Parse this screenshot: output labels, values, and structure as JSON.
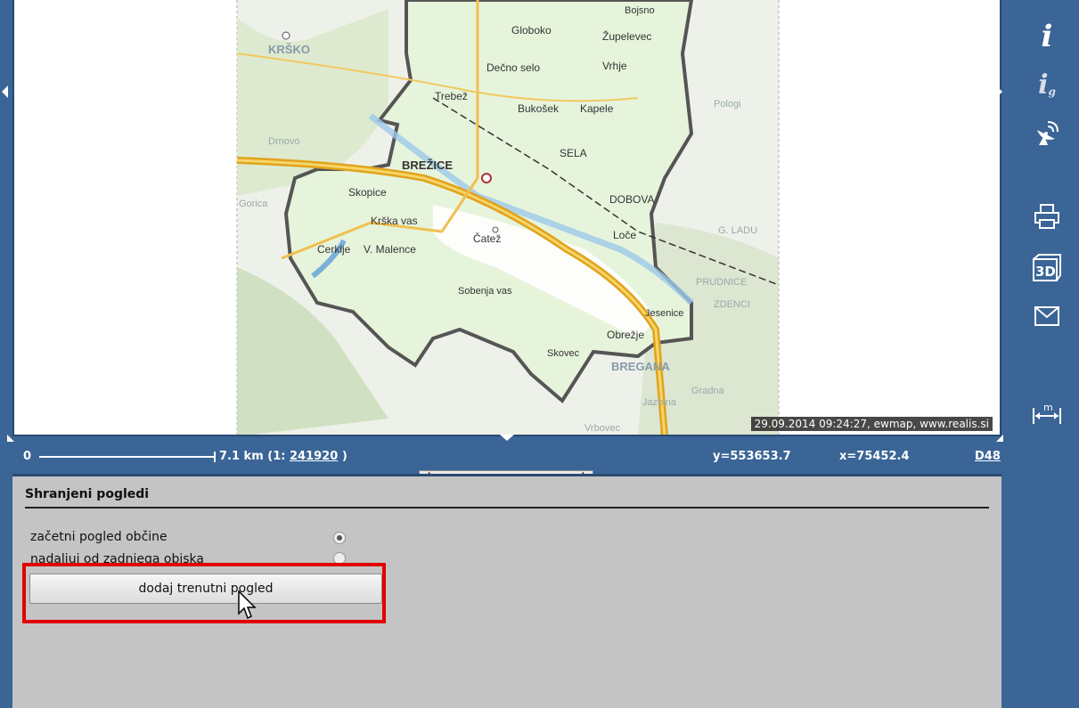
{
  "map": {
    "stamp": "29.09.2014 09:24:27, ewmap, www.realis.si",
    "place_labels": {
      "brezice": "BREŽICE",
      "krsko": "KRŠKO",
      "bregana": "BREGANA",
      "dobova": "DOBOVA",
      "catez": "Čatež",
      "skopice": "Skopice",
      "krska_vas": "Krška vas",
      "cerklje": "Cerklje",
      "velike_malence": "V. Malence",
      "globoko": "Globoko",
      "zupelevec": "Župelevec",
      "vrhje": "Vrhje",
      "desno_selo": "Dečno selo",
      "trebez": "Trebež",
      "bukosek": "Bukošek",
      "kapele": "Kapele",
      "sela": "SELA",
      "loce": "Loče",
      "obrezje": "Obrežje",
      "jesenice": "Jesenice",
      "sobenja_vas": "Sobenja vas",
      "pologi": "Pologi",
      "prudnice": "PRUDNICE",
      "zdenci": "ZDENCI",
      "g_ladu": "G. LADU",
      "gradna": "Gradna",
      "jazbina": "Jazbina",
      "dmovo": "Drnovo",
      "bojsno": "Bojsno",
      "skovec": "Skovec",
      "gorica": "Gorica",
      "vrbovec": "Vrbovec"
    }
  },
  "status": {
    "scale_zero": "0",
    "scale_distance": "7.1 km (1:",
    "scale_ratio": "241920",
    "scale_close": ")",
    "coord_y": "y=553653.7",
    "coord_x": "x=75452.4",
    "datum": "D48"
  },
  "toolbar": {
    "info": "i",
    "info_g": "i",
    "info_g_sub": "g",
    "threed": "3D",
    "measure": "m"
  },
  "panel": {
    "title": "Shranjeni pogledi",
    "options": [
      {
        "label": "začetni pogled občine",
        "checked": true
      },
      {
        "label": "nadaljuj od zadnjega obiska",
        "checked": false
      }
    ],
    "add_button": "dodaj trenutni pogled"
  }
}
